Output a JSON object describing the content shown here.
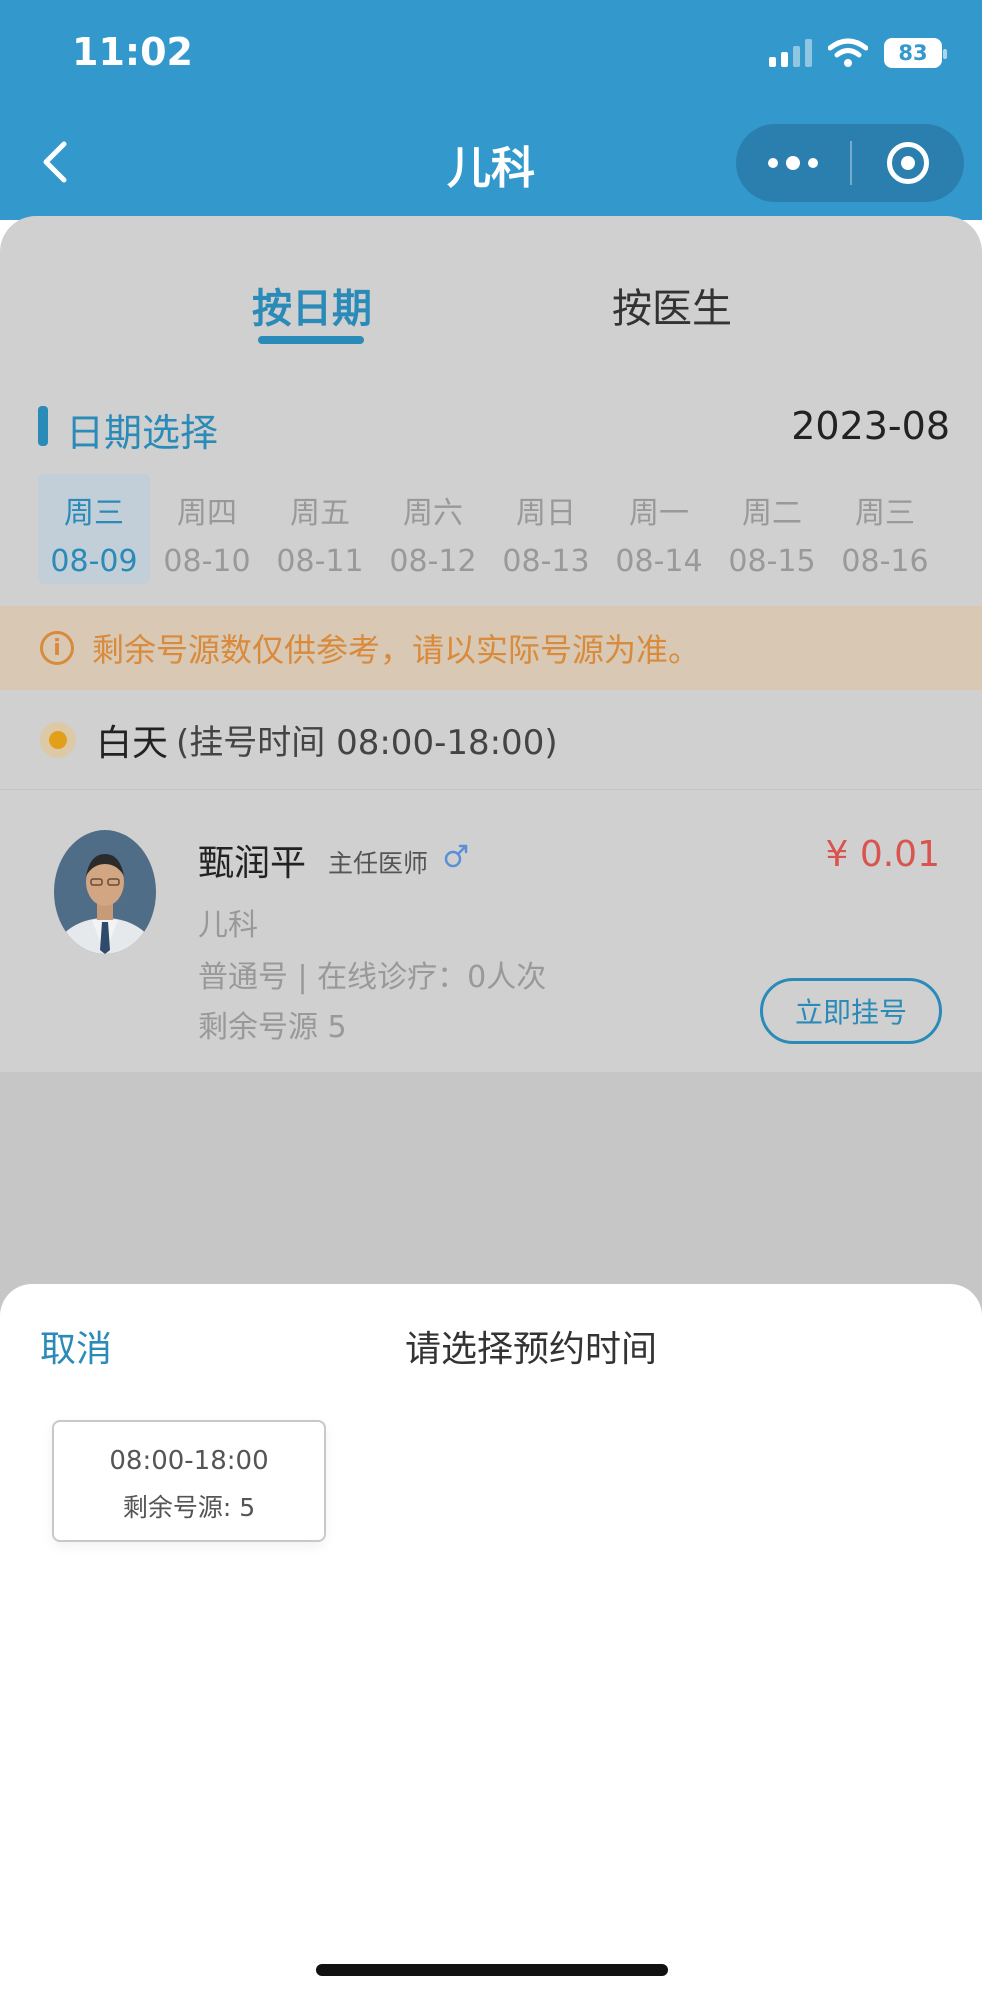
{
  "status_bar": {
    "time": "11:02",
    "battery": "83"
  },
  "nav": {
    "title": "儿科"
  },
  "tabs": {
    "by_date": "按日期",
    "by_doctor": "按医生"
  },
  "date_section": {
    "title": "日期选择",
    "month": "2023-08"
  },
  "days": [
    {
      "weekday": "周三",
      "date": "08-09"
    },
    {
      "weekday": "周四",
      "date": "08-10"
    },
    {
      "weekday": "周五",
      "date": "08-11"
    },
    {
      "weekday": "周六",
      "date": "08-12"
    },
    {
      "weekday": "周日",
      "date": "08-13"
    },
    {
      "weekday": "周一",
      "date": "08-14"
    },
    {
      "weekday": "周二",
      "date": "08-15"
    },
    {
      "weekday": "周三",
      "date": "08-16"
    }
  ],
  "notice": {
    "icon": "i",
    "text": "剩余号源数仅供参考，请以实际号源为准。"
  },
  "period": {
    "label": "白天",
    "range": "(挂号时间 08:00-18:00)"
  },
  "doctor": {
    "name": "甄润平",
    "title": "主任医师",
    "price": "¥ 0.01",
    "dept": "儿科",
    "type": "普通号 | 在线诊疗：0人次",
    "remain": "剩余号源 5",
    "book_label": "立即挂号"
  },
  "sheet": {
    "cancel": "取消",
    "title": "请选择预约时间",
    "slot_time": "08:00-18:00",
    "slot_remain": "剩余号源: 5"
  },
  "colors": {
    "brand_blue": "#3399cc",
    "accent_blue": "#2a8ab8",
    "price_red": "#d9534f",
    "notice_orange": "#d98a3a"
  }
}
